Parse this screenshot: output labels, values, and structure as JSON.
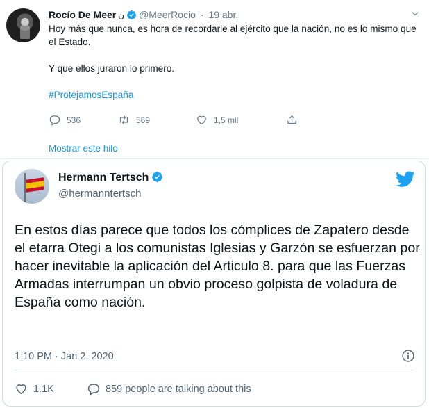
{
  "tweet": {
    "author_name": "Rocío De Meer",
    "author_suffix": "ن",
    "handle": "@MeerRocio",
    "dot": "·",
    "date": "19 abr.",
    "text_line1": "Hoy más que nunca, es hora de recordarle al ejército que la nación, no es lo mismo que el Estado.",
    "text_line2": "Y que ellos juraron lo primero.",
    "hashtag": "#ProtejamosEspaña",
    "replies": "536",
    "retweets": "569",
    "likes": "1,5 mil",
    "show_thread": "Mostrar este hilo"
  },
  "embedded": {
    "author_name": "Hermann Tertsch",
    "handle": "@hermanntertsch",
    "text": "En estos días parece que todos los cómplices de Zapatero desde el etarra Otegi a los comunistas Iglesias y Garzón se esfuerzan por hacer inevitable la aplicación del Articulo 8. para que las Fuerzas Armadas interrumpan un obvio proceso golpista de voladura de España como nación.",
    "timestamp": "1:10 PM · Jan 2, 2020",
    "likes": "1.1K",
    "talking": "859 people are talking about this"
  },
  "colors": {
    "accent": "#1b95e0",
    "twitter_blue": "#1da1f2",
    "secondary_text": "#657786"
  },
  "icons": [
    "verified-badge-icon",
    "chevron-down-icon",
    "reply-icon",
    "retweet-icon",
    "like-icon",
    "share-icon",
    "twitter-bird-icon",
    "info-icon"
  ]
}
